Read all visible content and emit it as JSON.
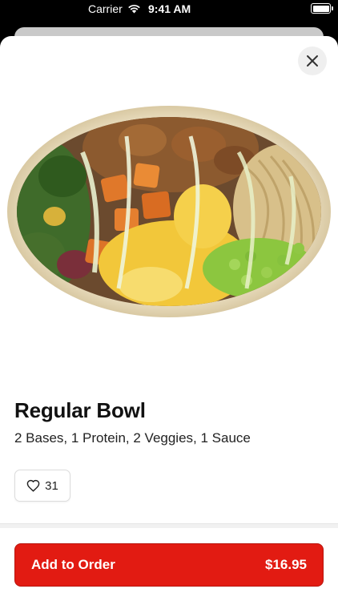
{
  "status_bar": {
    "carrier": "Carrier",
    "time": "9:41 AM"
  },
  "product": {
    "title": "Regular Bowl",
    "description": "2 Bases, 1 Protein, 2 Veggies, 1 Sauce",
    "image_icon": "grain-bowl-photo"
  },
  "like": {
    "count": "31",
    "icon": "heart-outline-icon"
  },
  "order_button": {
    "label": "Add to Order",
    "price": "$16.95",
    "color": "#e21b12"
  },
  "close": {
    "icon": "close-icon"
  }
}
